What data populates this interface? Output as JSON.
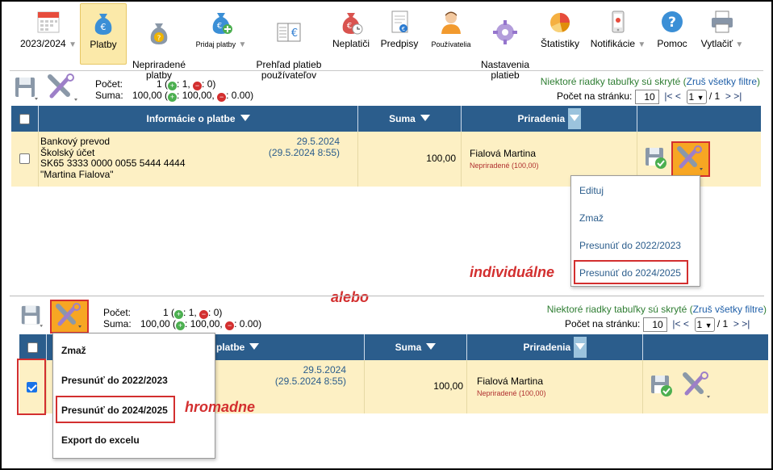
{
  "toolbar": {
    "items": [
      {
        "label": "2023/2024",
        "icon": "calendar-icon"
      },
      {
        "label": "Platby",
        "icon": "money-bag-euro-icon"
      },
      {
        "label": "Nepriradené\nplatby",
        "icon": "money-bag-question-icon"
      },
      {
        "label": "Pridaj platby",
        "icon": "money-bag-add-icon"
      },
      {
        "label": "Prehľad platieb\npoužívateľov",
        "icon": "ledger-euro-icon"
      },
      {
        "label": "Neplatiči",
        "icon": "money-bag-clock-icon"
      },
      {
        "label": "Predpisy",
        "icon": "document-euro-icon"
      },
      {
        "label": "Používatelia",
        "icon": "user-icon"
      },
      {
        "label": "Nastavenia\nplatieb",
        "icon": "gear-icon"
      },
      {
        "label": "Štatistiky",
        "icon": "pie-chart-icon"
      },
      {
        "label": "Notifikácie",
        "icon": "phone-icon"
      },
      {
        "label": "Pomoc",
        "icon": "help-icon"
      },
      {
        "label": "Vytlačiť",
        "icon": "printer-icon"
      }
    ]
  },
  "section1": {
    "summary": {
      "count_label": "Počet:",
      "count_value": "1 (",
      "count_plus": "1",
      "count_minus": "0",
      "sum_label": "Suma:",
      "sum_value": "100,00 (",
      "sum_plus": "100,00",
      "sum_minus": "0.00"
    },
    "hidden_note": "Niektoré riadky tabuľky sú skryté",
    "hidden_link": "Zruš všetky filtre",
    "per_page_label": "Počet na stránku:",
    "per_page_value": "10",
    "page_nav_prev": "|< <",
    "page_select": "1",
    "page_total": "/ 1",
    "page_nav_next": "> >|",
    "headers": [
      "Informácie o platbe",
      "Suma",
      "Priradenia"
    ],
    "row": {
      "info_line1": "Bankový prevod",
      "info_line2": "Školský účet",
      "info_line3": "SK65 3333 0000 0055 5444 4444",
      "info_line4": "\"Martina Fialova\"",
      "date1": "29.5.2024",
      "date2": "(29.5.2024 8:55)",
      "amount": "100,00",
      "assign_name": "Fialová Martina",
      "assign_status": "Nepriradené (100,00)"
    },
    "menu": [
      "Edituj",
      "Zmaž",
      "Presunúť do 2022/2023",
      "Presunúť do 2024/2025"
    ]
  },
  "annotations": {
    "individual": "individuálne",
    "or": "alebo",
    "bulk": "hromadne"
  },
  "section2": {
    "summary": {
      "count_label": "Počet:",
      "count_value": "1 (",
      "count_plus": "1",
      "count_minus": "0",
      "sum_label": "Suma:",
      "sum_value": "100,00 (",
      "sum_plus": "100,00",
      "sum_minus": "0.00"
    },
    "hidden_note": "Niektoré riadky tabuľky sú skryté",
    "hidden_link": "Zruš všetky filtre",
    "per_page_label": "Počet na stránku:",
    "per_page_value": "10",
    "page_nav_prev": "|< <",
    "page_select": "1",
    "page_total": "/ 1",
    "page_nav_next": "> >|",
    "headers": [
      "platbe",
      "Suma",
      "Priradenia"
    ],
    "row": {
      "date1": "29.5.2024",
      "date2": "(29.5.2024 8:55)",
      "amount": "100,00",
      "assign_name": "Fialová Martina",
      "assign_status": "Nepriradené (100,00)"
    },
    "menu": [
      "Zmaž",
      "Presunúť do 2022/2023",
      "Presunúť do 2024/2025",
      "Export do excelu"
    ]
  },
  "colors": {
    "header_blue": "#2b5d8c",
    "row_yellow": "#fdf0c4",
    "highlight_red": "#d32f2f",
    "link_blue": "#1f5fa8",
    "note_green": "#2e7d32",
    "tool_orange": "#f7a623"
  }
}
